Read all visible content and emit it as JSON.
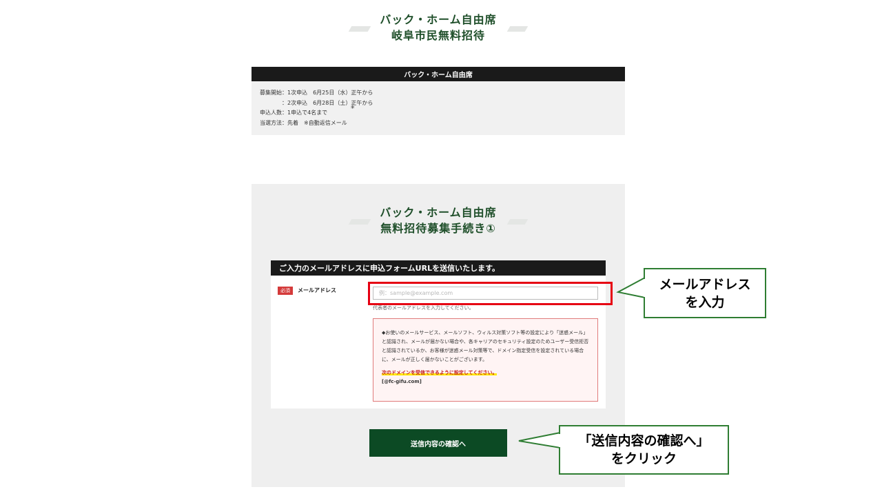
{
  "top_heading": {
    "line1": "バック・ホーム自由席",
    "line2": "岐阜市民無料招待"
  },
  "info": {
    "header": "バック・ホーム自由席",
    "lines": [
      "募集開始：1次申込　6月25日（水）正午から",
      "　　　　：2次申込　6月28日（土）正午から",
      "申込人数：1申込で4名まで",
      "当選方法：先着　※自動返信メール"
    ],
    "asterisk": "*"
  },
  "form_heading": {
    "line1": "バック・ホーム自由席",
    "line2": "無料招待募集手続き①"
  },
  "form": {
    "header": "ご入力のメールアドレスに申込フォームURLを送信いたします。",
    "required_badge": "必須",
    "email_label": "メールアドレス",
    "email_placeholder": "例：sample@example.com",
    "email_value": "",
    "email_help": "代表者のメールアドレスを入力してください。",
    "notice_text": "◆お使いのメールサービス、メールソフト、ウィルス対策ソフト等の設定により「迷惑メール」と認識され、メールが届かない場合や、各キャリアのセキュリティ設定のためユーザー受信拒否と認識されているか、お客様が迷惑メール対策等で、ドメイン指定受信を設定されている場合に、メールが正しく届かないことがございます。",
    "notice_domain_instruction": "次のドメインを受信できるように設定してください。",
    "notice_domain": "[@fc-gifu.com]",
    "submit_label": "送信内容の確認へ"
  },
  "callouts": {
    "email": {
      "line1": "メールアドレス",
      "line2": "を入力"
    },
    "submit": {
      "line1": "「送信内容の確認へ」",
      "line2": "をクリック"
    }
  },
  "colors": {
    "brand_green": "#0c4a24",
    "heading_green": "#1f4f2a",
    "highlight_red": "#e60012",
    "callout_border": "#2e7d32"
  }
}
